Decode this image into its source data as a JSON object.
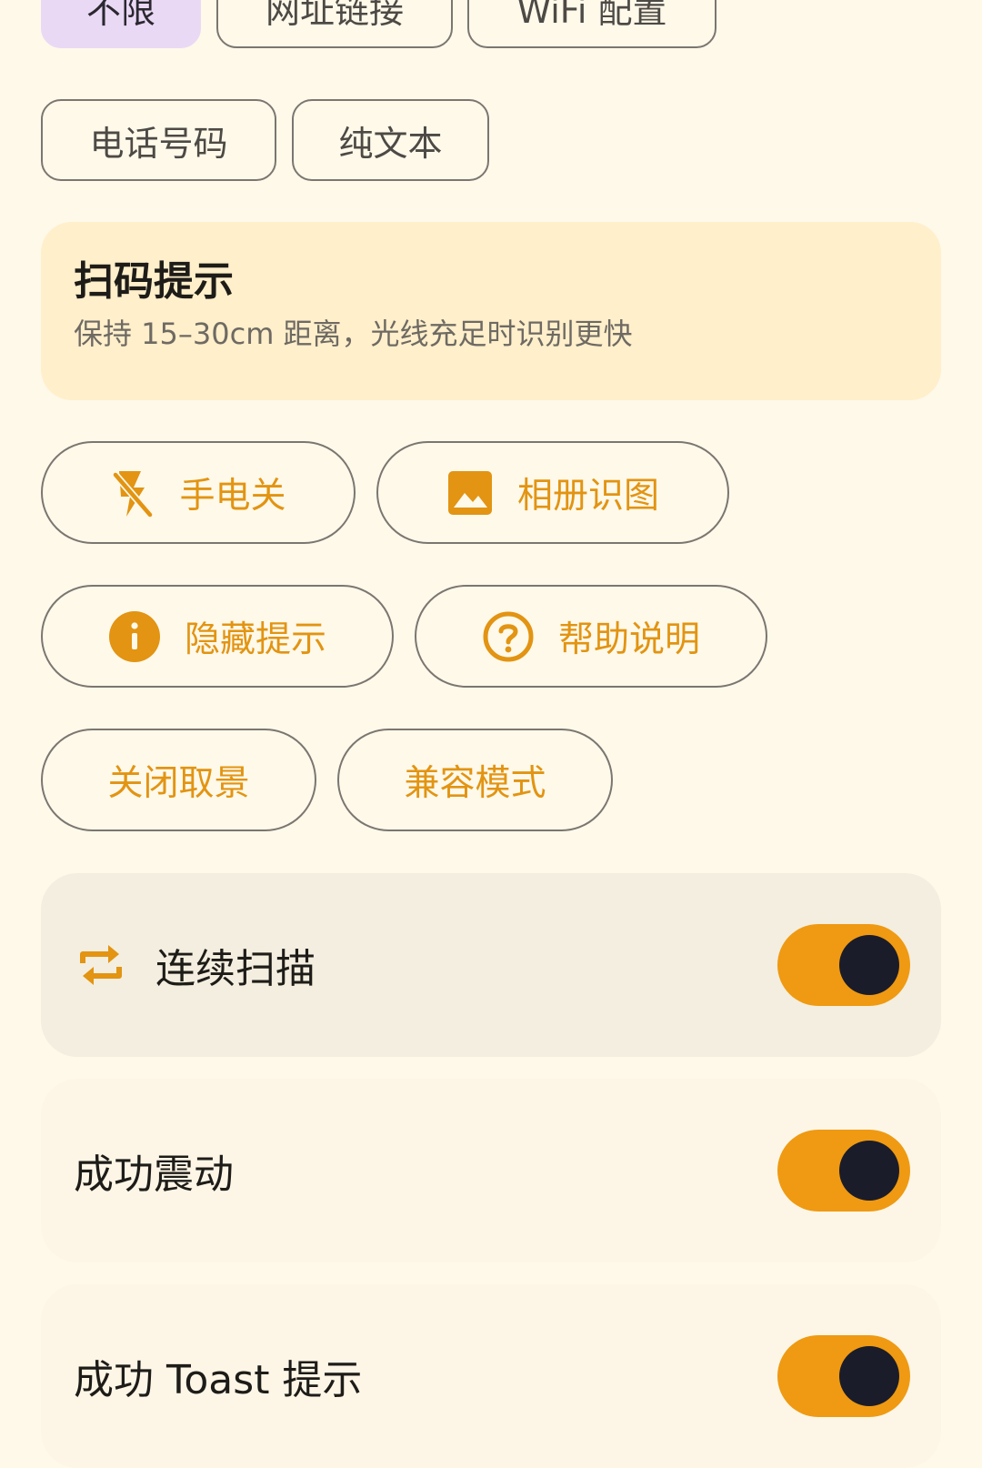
{
  "filter_chips": {
    "unlimited": "不限",
    "url": "网址链接",
    "wifi": "WiFi 配置",
    "phone": "电话号码",
    "text": "纯文本"
  },
  "tip": {
    "title": "扫码提示",
    "subtitle": "保持 15–30cm 距离，光线充足时识别更快"
  },
  "actions": {
    "flashlight": "手电关",
    "album": "相册识图",
    "hide_tip": "隐藏提示",
    "help": "帮助说明",
    "close_viewfinder": "关闭取景",
    "compat_mode": "兼容模式"
  },
  "settings": [
    {
      "label": "连续扫描",
      "icon": "repeat-icon",
      "enabled": true
    },
    {
      "label": "成功震动",
      "enabled": true
    },
    {
      "label": "成功 Toast 提示",
      "enabled": true
    }
  ],
  "colors": {
    "accent": "#EF9A12",
    "background": "#FFF9EA",
    "selected_chip": "#EAD9F5",
    "tip_card": "#FFEFCB"
  }
}
